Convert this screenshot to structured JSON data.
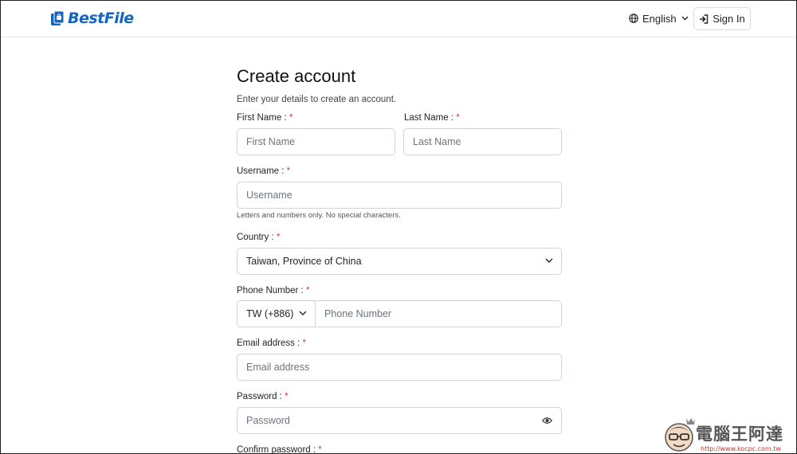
{
  "header": {
    "brand": "BestFile",
    "language": "English",
    "signin_label": "Sign In"
  },
  "form": {
    "title": "Create account",
    "subtitle": "Enter your details to create an account.",
    "first_name": {
      "label": "First Name : ",
      "placeholder": "First Name"
    },
    "last_name": {
      "label": "Last Name : ",
      "placeholder": "Last Name"
    },
    "username": {
      "label": "Username : ",
      "placeholder": "Username",
      "hint": "Letters and numbers only. No special characters."
    },
    "country": {
      "label": "Country : ",
      "value": "Taiwan, Province of China"
    },
    "phone": {
      "label": "Phone Number : ",
      "code": "TW (+886)",
      "placeholder": "Phone Number"
    },
    "email": {
      "label": "Email address : ",
      "placeholder": "Email address"
    },
    "password": {
      "label": "Password : ",
      "placeholder": "Password"
    },
    "confirm_password": {
      "label": "Confirm password : "
    },
    "required_mark": "*"
  },
  "watermark": {
    "text": "電腦王阿達",
    "url": "http://www.kocpc.com.tw"
  },
  "colors": {
    "brand": "#1565c0",
    "required": "#dc3545",
    "border": "#ced4da"
  }
}
